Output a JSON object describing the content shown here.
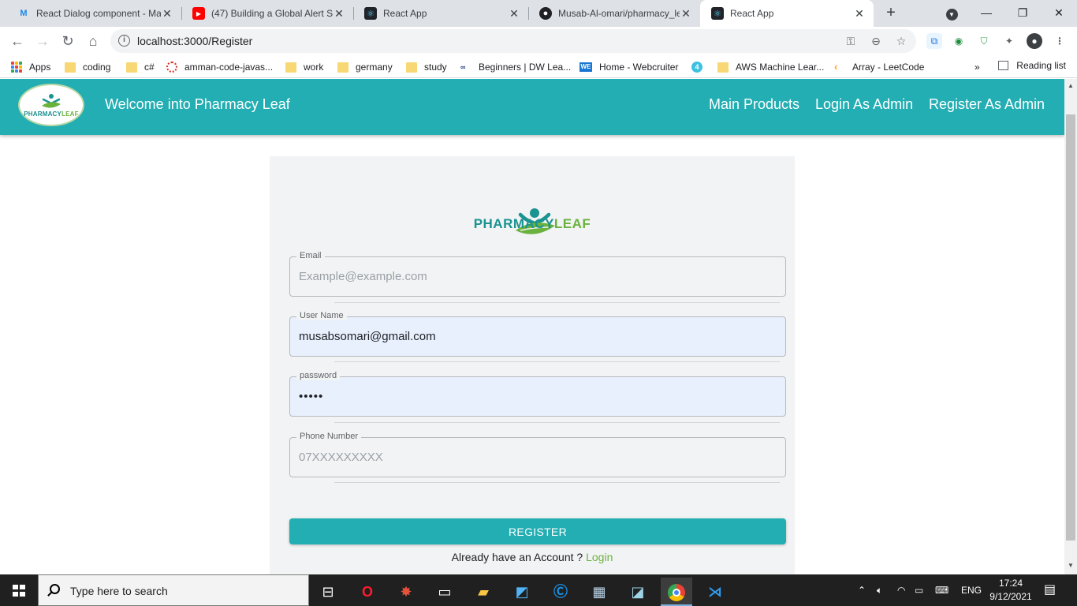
{
  "browser": {
    "tabs": [
      {
        "title": "React Dialog component - Ma",
        "icon": "mui-icon",
        "color": "#1e88e5",
        "active": false
      },
      {
        "title": "(47) Building a Global Alert Sy",
        "icon": "youtube-icon",
        "color": "#ff0000",
        "active": false
      },
      {
        "title": "React App",
        "icon": "react-icon",
        "color": "#61dafb",
        "active": false
      },
      {
        "title": "Musab-Al-omari/pharmacy_le",
        "icon": "github-icon",
        "color": "#202124",
        "active": false
      },
      {
        "title": "React App",
        "icon": "react-icon",
        "color": "#61dafb",
        "active": true
      }
    ],
    "url": "localhost:3000/Register",
    "bookmarks": [
      {
        "label": "Apps",
        "icon": "apps-grid-icon"
      },
      {
        "label": "coding",
        "icon": "folder-icon"
      },
      {
        "label": "c#",
        "icon": "folder-icon"
      },
      {
        "label": "amman-code-javas...",
        "icon": "codefellows-icon"
      },
      {
        "label": "work",
        "icon": "folder-icon"
      },
      {
        "label": "germany",
        "icon": "folder-icon"
      },
      {
        "label": "study",
        "icon": "folder-icon"
      },
      {
        "label": "Beginners | DW Lea...",
        "icon": "dw-icon"
      },
      {
        "label": "Home - Webcruiter",
        "icon": "webcruiter-icon"
      },
      {
        "label": "",
        "icon": "four-icon"
      },
      {
        "label": "AWS Machine Lear...",
        "icon": "folder-icon"
      },
      {
        "label": "Array - LeetCode",
        "icon": "leetcode-icon"
      }
    ],
    "more_bookmarks": "»",
    "reading_list": "Reading list"
  },
  "app": {
    "brand_main": "PHARMACY",
    "brand_accent": "LEAF",
    "title": "Welcome into Pharmacy Leaf",
    "nav": [
      "Main Products",
      "Login As Admin",
      "Register As Admin"
    ],
    "accent_color": "#22aeb2",
    "leaf_color": "#6ab23e"
  },
  "form": {
    "brand_main": "PHARMACY",
    "brand_accent": "LEAF",
    "email": {
      "label": "Email",
      "value": "",
      "placeholder": "Example@example.com"
    },
    "username": {
      "label": "User Name",
      "value": "musabsomari@gmail.com",
      "placeholder": ""
    },
    "password": {
      "label": "password",
      "value": "12345",
      "placeholder": ""
    },
    "phone": {
      "label": "Phone Number",
      "value": "",
      "placeholder": "07XXXXXXXXX"
    },
    "register_label": "REGISTER",
    "already_text": "Already have an Account ? ",
    "login_link": "Login"
  },
  "taskbar": {
    "search_placeholder": "Type here to search",
    "language": "ENG",
    "time": "17:24",
    "date": "9/12/2021"
  }
}
